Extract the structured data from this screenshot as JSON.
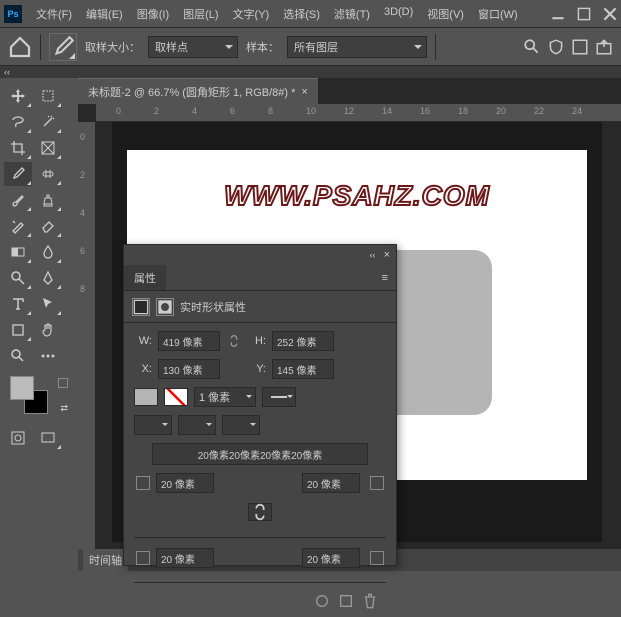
{
  "menus": [
    "文件(F)",
    "编辑(E)",
    "图像(I)",
    "图层(L)",
    "文字(Y)",
    "选择(S)",
    "滤镜(T)",
    "3D(D)",
    "视图(V)",
    "窗口(W)"
  ],
  "optbar": {
    "sample_size_label": "取样大小：",
    "sample_size_value": "取样点",
    "sample_label": "样本：",
    "sample_value": "所有图层"
  },
  "doc": {
    "tab": "未标题-2 @ 66.7% (圆角矩形 1, RGB/8#) *",
    "zoom": "66.67%"
  },
  "ruler_h": [
    "0",
    "2",
    "4",
    "6",
    "8",
    "10",
    "12",
    "14",
    "16",
    "18",
    "20",
    "22",
    "24"
  ],
  "ruler_v": [
    "0",
    "2",
    "4",
    "6",
    "8"
  ],
  "watermark": "WWW.PSAHZ.COM",
  "timeline": {
    "label": "时间轴"
  },
  "panel": {
    "tab": "属性",
    "sub": "实时形状属性",
    "w_label": "W:",
    "w_value": "419 像素",
    "h_label": "H:",
    "h_value": "252 像素",
    "x_label": "X:",
    "x_value": "130 像素",
    "y_label": "Y:",
    "y_value": "145 像素",
    "stroke_width": "1 像素",
    "radius_summary": "20像素20像素20像素20像素",
    "tl": "20 像素",
    "tr": "20 像素",
    "bl": "20 像素",
    "br": "20 像素"
  }
}
